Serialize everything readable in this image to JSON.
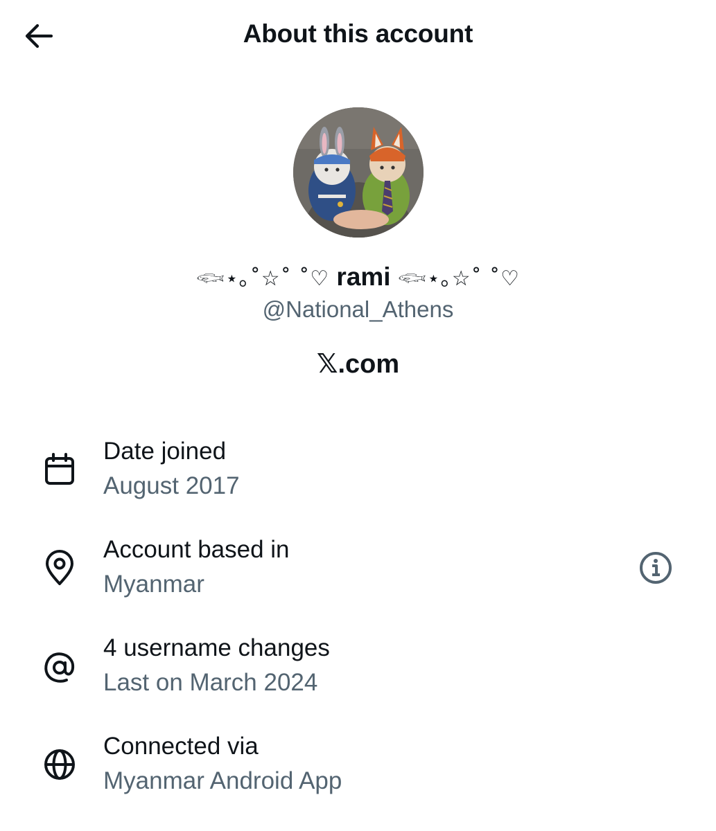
{
  "header": {
    "back_icon": "arrow-left-icon",
    "title": "About this account"
  },
  "profile": {
    "avatar_icon": "avatar-two-cats-in-costumes",
    "name_prefix_deco": "𓆟⋆｡˚☆˚ ˚♡",
    "name": "rami",
    "name_suffix_deco": "𓆟⋆｡☆˚ ˚♡",
    "handle": "@National_Athens",
    "platform": "𝕏.com"
  },
  "details": [
    {
      "icon": "calendar-icon",
      "title": "Date joined",
      "value": "August 2017"
    },
    {
      "icon": "location-pin-icon",
      "title": "Account based in",
      "value": "Myanmar",
      "action_icon": "info-icon"
    },
    {
      "icon": "at-sign-icon",
      "title": "4 username changes",
      "value": "Last on March 2024"
    },
    {
      "icon": "globe-icon",
      "title": "Connected via",
      "value": "Myanmar Android App"
    }
  ],
  "colors": {
    "text_primary": "#0f1419",
    "text_secondary": "#536471",
    "background": "#ffffff"
  }
}
